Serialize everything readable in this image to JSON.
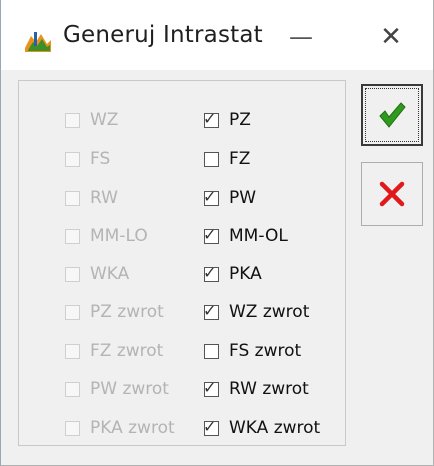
{
  "window": {
    "title": "Generuj Intrastat",
    "minimize_glyph": "—",
    "close_glyph": "✕",
    "icon": "app-icon"
  },
  "checkboxes": {
    "left": [
      {
        "label": "WZ",
        "checked": false,
        "enabled": false
      },
      {
        "label": "FS",
        "checked": false,
        "enabled": false
      },
      {
        "label": "RW",
        "checked": false,
        "enabled": false
      },
      {
        "label": "MM-LO",
        "checked": false,
        "enabled": false
      },
      {
        "label": "WKA",
        "checked": false,
        "enabled": false
      },
      {
        "label": "PZ zwrot",
        "checked": false,
        "enabled": false
      },
      {
        "label": "FZ zwrot",
        "checked": false,
        "enabled": false
      },
      {
        "label": "PW zwrot",
        "checked": false,
        "enabled": false
      },
      {
        "label": "PKA zwrot",
        "checked": false,
        "enabled": false
      }
    ],
    "right": [
      {
        "label": "PZ",
        "checked": true,
        "enabled": true
      },
      {
        "label": "FZ",
        "checked": false,
        "enabled": true
      },
      {
        "label": "PW",
        "checked": true,
        "enabled": true
      },
      {
        "label": "MM-OL",
        "checked": true,
        "enabled": true
      },
      {
        "label": "PKA",
        "checked": true,
        "enabled": true
      },
      {
        "label": "WZ zwrot",
        "checked": true,
        "enabled": true
      },
      {
        "label": "FS zwrot",
        "checked": false,
        "enabled": true
      },
      {
        "label": "RW zwrot",
        "checked": true,
        "enabled": true
      },
      {
        "label": "WKA zwrot",
        "checked": true,
        "enabled": true
      }
    ]
  },
  "buttons": {
    "ok_icon": "green-checkmark-icon",
    "cancel_icon": "red-x-icon"
  },
  "colors": {
    "ok_green": "#2e9a1e",
    "cancel_red": "#e0191b",
    "disabled_text": "#b4b4b4"
  }
}
